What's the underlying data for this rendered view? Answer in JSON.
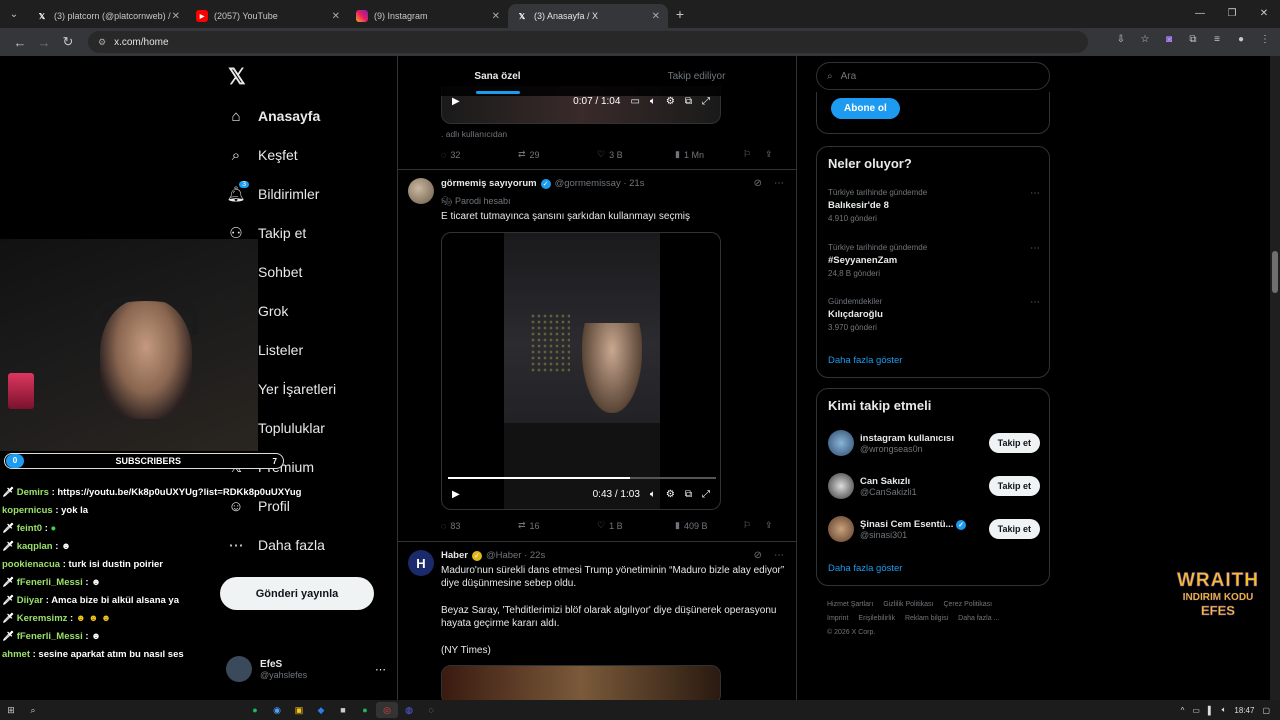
{
  "browser": {
    "tabs": [
      {
        "title": "(3) platcorn (@platcornweb) / X",
        "icon": "x-logo",
        "active": false
      },
      {
        "title": "(2057) YouTube",
        "icon": "youtube-logo",
        "active": false
      },
      {
        "title": "(9) Instagram",
        "icon": "instagram-logo",
        "active": false
      },
      {
        "title": "(3) Anasayfa / X",
        "icon": "x-logo",
        "active": true
      }
    ],
    "url": "x.com/home"
  },
  "nav": {
    "items": [
      {
        "label": "Anasayfa",
        "icon": "home-icon"
      },
      {
        "label": "Keşfet",
        "icon": "search-icon"
      },
      {
        "label": "Bildirimler",
        "icon": "bell-icon",
        "badge": "3"
      },
      {
        "label": "Takip et",
        "icon": "follow-icon"
      },
      {
        "label": "Sohbet",
        "icon": "mail-icon"
      },
      {
        "label": "Grok",
        "icon": "grok-icon"
      },
      {
        "label": "Listeler",
        "icon": "list-icon"
      },
      {
        "label": "Yer İşaretleri",
        "icon": "bookmark-icon"
      },
      {
        "label": "Topluluklar",
        "icon": "communities-icon"
      },
      {
        "label": "Premium",
        "icon": "premium-icon"
      },
      {
        "label": "Profil",
        "icon": "profile-icon"
      },
      {
        "label": "Daha fazla",
        "icon": "more-icon"
      }
    ],
    "post_button": "Gönderi yayınla",
    "profile": {
      "name": "EfeS",
      "handle": "@yahslefes"
    }
  },
  "feed": {
    "tabs": [
      "Sana özel",
      "Takip ediliyor"
    ],
    "post1": {
      "video_time": "0:07 / 1:04",
      "caption": ". adlı kullanıcıdan",
      "stats": {
        "replies": "32",
        "reposts": "29",
        "likes": "3 B",
        "views": "1 Mn"
      }
    },
    "post2": {
      "name": "görmemiş sayıyorum",
      "handle": "@gormemissay · 21s",
      "label": "Parodi hesabı",
      "text": "E ticaret tutmayınca şansını şarkıdan kullanmayı seçmiş",
      "video_time": "0:43 / 1:03",
      "video_progress": 0.68,
      "stats": {
        "replies": "83",
        "reposts": "16",
        "likes": "1 B",
        "views": "409 B"
      }
    },
    "post3": {
      "name": "Haber",
      "handle": "@Haber · 22s",
      "avatar_letter": "H",
      "text1": "Maduro'nun sürekli dans etmesi Trump yönetiminin “Maduro bizle alay ediyor” diye düşünmesine sebep oldu.",
      "text2": "Beyaz Saray, 'Tehditlerimizi blöf olarak algılıyor' diye düşünerek operasyonu hayata geçirme kararı aldı.",
      "text3": "(NY Times)"
    }
  },
  "right": {
    "search_placeholder": "Ara",
    "subscribe": "Abone ol",
    "trends_title": "Neler oluyor?",
    "trends": [
      {
        "context": "Türkiye tarihinde gündemde",
        "title": "Balıkesir'de 8",
        "count": "4.910 gönderi"
      },
      {
        "context": "Türkiye tarihinde gündemde",
        "title": "#SeyyanenZam",
        "count": "24,8 B gönderi"
      },
      {
        "context": "Gündemdekiler",
        "title": "Kılıçdaroğlu",
        "count": "3.970 gönderi"
      }
    ],
    "show_more": "Daha fazla göster",
    "wtf_title": "Kimi takip etmeli",
    "wtf": [
      {
        "name": "instagram kullanıcısı",
        "handle": "@wrongseas0n",
        "verified": false
      },
      {
        "name": "Can Sakızlı",
        "handle": "@CanSakizli1",
        "verified": false
      },
      {
        "name": "Şinasi Cem Esentü...",
        "handle": "@sinasi301",
        "verified": true
      }
    ],
    "follow_label": "Takip et",
    "footer": [
      "Hizmet Şartları",
      "Gizlilik Politikası",
      "Çerez Politikası",
      "Imprint",
      "Erişilebilirlik",
      "Reklam bilgisi",
      "Daha fazla ...",
      "© 2026 X Corp."
    ]
  },
  "overlay": {
    "subs": {
      "left": "0",
      "label": "SUBSCRIBERS",
      "right": "7"
    },
    "chat": [
      {
        "user": "Demirs",
        "msg": ": https://youtu.be/Kk8p0uUXYUg?list=RDKk8p0uUXYug"
      },
      {
        "user": "kopernicus",
        "msg": ": yok la"
      },
      {
        "user": "feint0",
        "msg": ":"
      },
      {
        "user": "kaqplan",
        "msg": ":"
      },
      {
        "user": "pookienacua",
        "msg": ": turk isi dustin poirier"
      },
      {
        "user": "fFenerli_Messi",
        "msg": ":"
      },
      {
        "user": "Diiyar",
        "msg": ": Amca bize bi alkül alsana ya"
      },
      {
        "user": "Keremsimz",
        "msg": ":"
      },
      {
        "user": "fFenerli_Messi",
        "msg": ":"
      },
      {
        "user": "ahmet",
        "msg": ": sesine aparkat atım bu nasıl ses"
      }
    ],
    "wraith": {
      "line1": "WRAITH",
      "line2": "INDIRIM KODU",
      "line3": "EFES"
    }
  },
  "taskbar": {
    "time": "18:47"
  }
}
